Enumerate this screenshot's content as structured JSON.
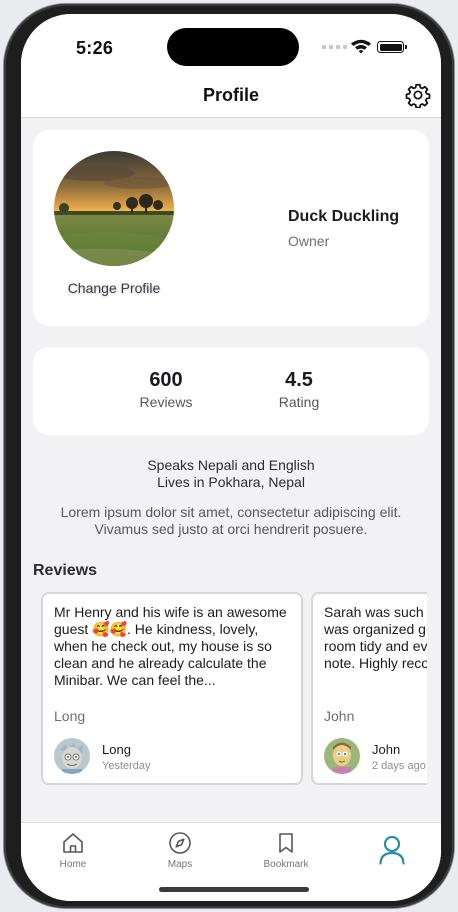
{
  "status_bar": {
    "time": "5:26"
  },
  "header": {
    "title": "Profile",
    "settings_icon": "gear-icon"
  },
  "profile": {
    "change_photo_label": "Change Profile",
    "name": "Duck Duckling",
    "role": "Owner"
  },
  "stats": [
    {
      "value": "600",
      "label": "Reviews"
    },
    {
      "value": "4.5",
      "label": "Rating"
    }
  ],
  "about": {
    "languages": "Speaks Nepali and English",
    "location": "Lives in Pokhara, Nepal",
    "bio": "Lorem ipsum dolor sit amet, consectetur adipiscing elit. Vivamus sed justo at orci hendrerit posuere."
  },
  "reviews": {
    "title": "Reviews",
    "items": [
      {
        "text": "Mr Henry and his wife is an awesome guest 🥰🥰. He kindness, lovely, when he check out, my house is so clean and he already calculate the Minibar. We can feel the...",
        "signature": "Long",
        "reviewer": "Long",
        "time": "Yesterday"
      },
      {
        "text": "Sarah was such a great guest. She was organized guest, she left the room tidy and even left a thank-you note. Highly recommended!",
        "signature": "John",
        "reviewer": "John",
        "time": "2 days ago"
      }
    ]
  },
  "tabs": [
    {
      "label": "Home",
      "icon": "home-icon"
    },
    {
      "label": "Maps",
      "icon": "compass-icon"
    },
    {
      "label": "Bookmark",
      "icon": "bookmark-icon"
    },
    {
      "label": "",
      "icon": "profile-icon",
      "active": true
    }
  ],
  "colors": {
    "accent": "#2a8ea8",
    "background": "#f2f2f4",
    "card": "#ffffff"
  }
}
